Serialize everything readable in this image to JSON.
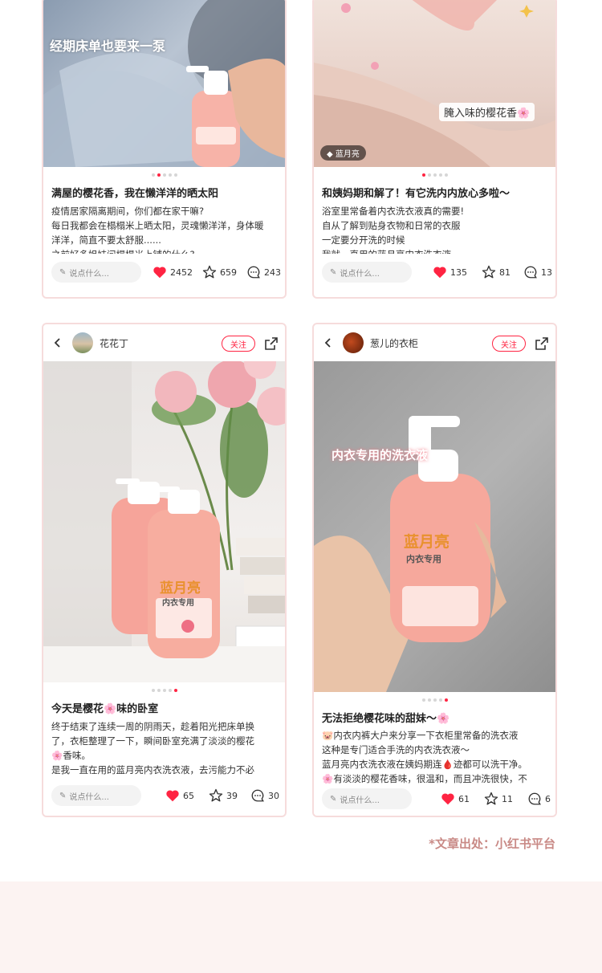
{
  "cards": [
    {
      "overlay": "经期床单也要来一泵",
      "title": "满屋的樱花香，我在懒洋洋的晒太阳",
      "lines": [
        "疫情居家隔离期间，你们都在家干嘛?",
        "每日我都会在榻榻米上晒太阳，灵魂懒洋洋，身体暖",
        "洋洋，简直不要太舒服......",
        "之前好多姐妹问榻榻米上铺的什么?"
      ],
      "comment_placeholder": "说点什么...",
      "likes": "2452",
      "collects": "659",
      "comments": "243"
    },
    {
      "overlay": "腌入味的樱花香🌸",
      "brand_tag": "蓝月亮",
      "title": "和姨妈期和解了！有它洗内内放心多啦～",
      "lines": [
        "浴室里常备着内衣洗衣液真的需要!",
        "自从了解到贴身衣物和日常的衣服",
        "一定要分开洗的时候",
        "我就一直用的蓝月亮内衣洗衣液"
      ],
      "comment_placeholder": "说点什么...",
      "likes": "135",
      "collects": "81",
      "comments": "13"
    },
    {
      "author": "花花丁",
      "follow": "关注",
      "title": "今天是樱花🌸味的卧室",
      "lines": [
        "终于结束了连续一周的阴雨天，趁着阳光把床单换",
        "了，衣柜整理了一下，瞬间卧室充满了淡淡的樱花",
        "🌸香味。",
        "是我一直在用的蓝月亮内衣洗衣液，去污能力不必"
      ],
      "comment_placeholder": "说点什么...",
      "likes": "65",
      "collects": "39",
      "comments": "30"
    },
    {
      "author": "葱儿的衣柜",
      "follow": "关注",
      "overlay": "内衣专用的洗衣液",
      "title": "无法拒绝樱花味的甜妹～🌸",
      "lines": [
        "🐷内衣内裤大户来分享一下衣柜里常备的洗衣液",
        "这种是专门适合手洗的内衣洗衣液～",
        "蓝月亮内衣洗衣液在姨妈期连🩸迹都可以洗干净。",
        "🌸有淡淡的樱花香味，很温和，而且冲洗很快，不"
      ],
      "comment_placeholder": "说点什么...",
      "likes": "61",
      "collects": "11",
      "comments": "6"
    }
  ],
  "brand_label": "蓝月亮",
  "product_label": "内衣专用",
  "source_note": "*文章出处：小红书平台",
  "colors": {
    "accent": "#ff2442",
    "border": "#f6dcdc",
    "source": "#c98a86"
  },
  "icons": [
    "heart-icon",
    "star-icon",
    "comment-icon",
    "pencil-icon",
    "back-icon",
    "share-icon"
  ]
}
